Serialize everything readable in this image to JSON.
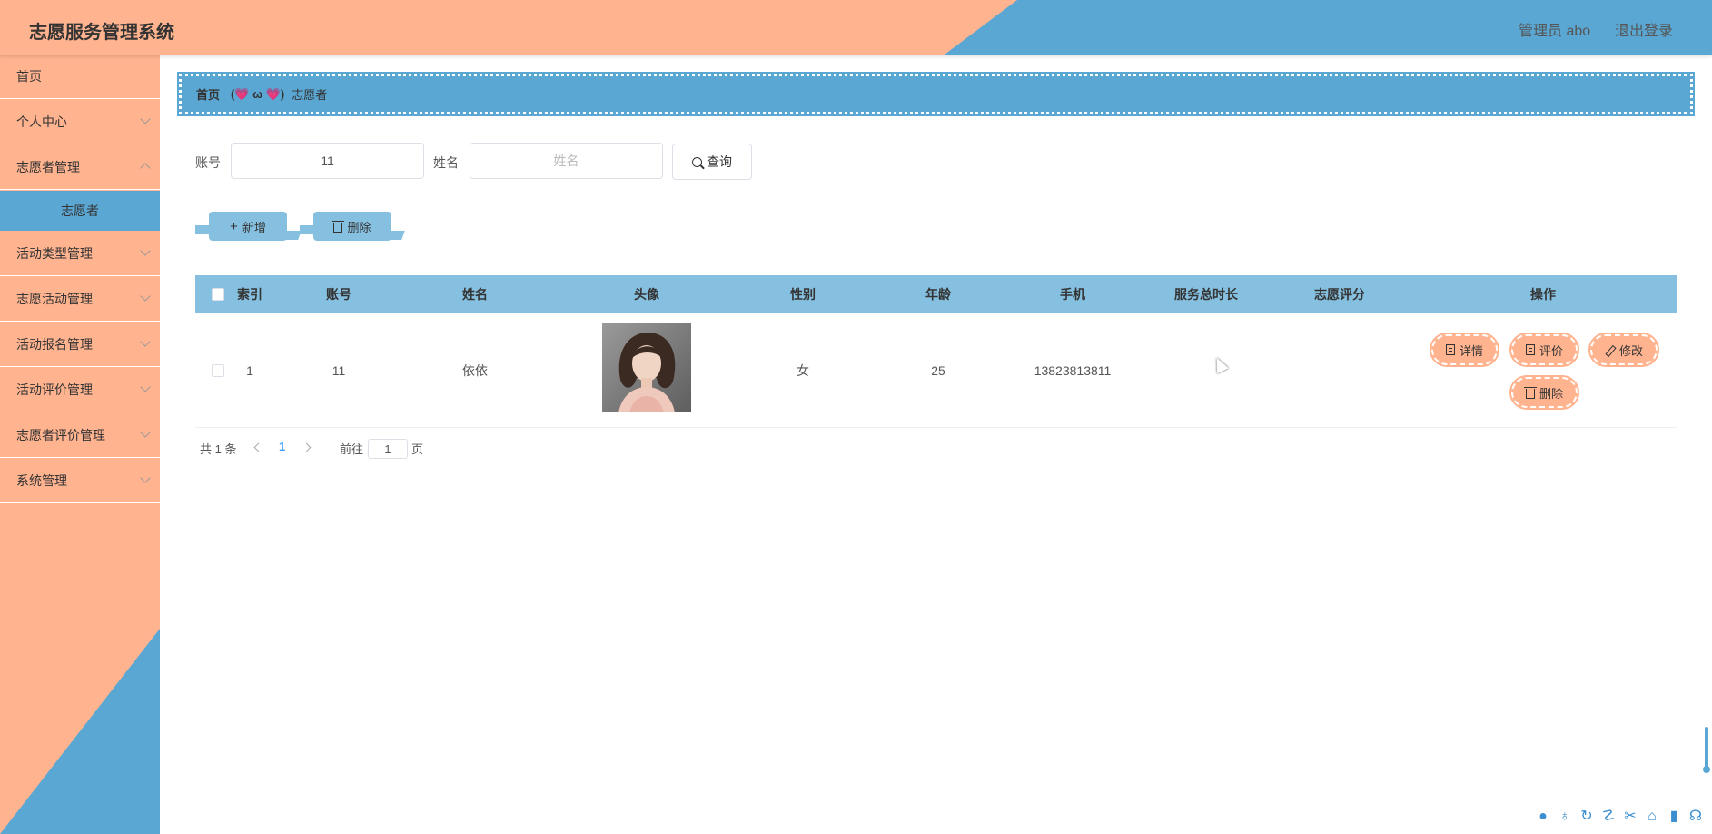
{
  "header": {
    "title": "志愿服务管理系统",
    "user": "管理员 abo",
    "logout": "退出登录"
  },
  "sidebar": {
    "items": [
      {
        "label": "首页"
      },
      {
        "label": "个人中心"
      },
      {
        "label": "志愿者管理"
      },
      {
        "label": "活动类型管理"
      },
      {
        "label": "志愿活动管理"
      },
      {
        "label": "活动报名管理"
      },
      {
        "label": "活动评价管理"
      },
      {
        "label": "志愿者评价管理"
      },
      {
        "label": "系统管理"
      }
    ],
    "sub_active": "志愿者"
  },
  "breadcrumb": {
    "home": "首页",
    "separator": "(💗 ω 💗)",
    "current": "志愿者"
  },
  "search": {
    "account_label": "账号",
    "account_value": "11",
    "name_label": "姓名",
    "name_placeholder": "姓名",
    "query_label": "查询"
  },
  "actions": {
    "add_label": "新增",
    "delete_label": "删除"
  },
  "table": {
    "columns": [
      "索引",
      "账号",
      "姓名",
      "头像",
      "性别",
      "年龄",
      "手机",
      "服务总时长",
      "志愿评分",
      "操作"
    ],
    "rows": [
      {
        "index": "1",
        "account": "11",
        "name": "依依",
        "gender": "女",
        "age": "25",
        "phone": "13823813811",
        "hours": "",
        "score": ""
      }
    ],
    "row_actions": {
      "detail": "详情",
      "rate": "评价",
      "edit": "修改",
      "delete": "删除"
    }
  },
  "pagination": {
    "total": "共 1 条",
    "current": "1",
    "goto_label": "前往",
    "goto_value": "1",
    "page_suffix": "页"
  },
  "colors": {
    "peach": "#ffb38f",
    "blue": "#5aa7d3",
    "light_blue": "#86c0e0"
  }
}
